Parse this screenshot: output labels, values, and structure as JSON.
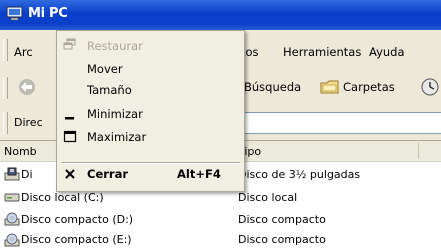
{
  "window": {
    "title": "Mi PC"
  },
  "menubar": {
    "items": [
      "Arc",
      "tos",
      "Herramientas",
      "Ayuda"
    ]
  },
  "toolbar": {
    "search_label": "Búsqueda",
    "folders_label": "Carpetas"
  },
  "address": {
    "label": "Direc"
  },
  "list": {
    "headers": {
      "name": "Nomb",
      "type": "Tipo"
    },
    "rows": [
      {
        "name": "Di",
        "type": "Disco de 3½ pulgadas",
        "icon": "floppy-drive-icon"
      },
      {
        "name": "Disco local (C:)",
        "type": "Disco local",
        "icon": "hard-drive-icon"
      },
      {
        "name": "Disco compacto (D:)",
        "type": "Disco compacto",
        "icon": "cd-drive-icon"
      },
      {
        "name": "Disco compacto (E:)",
        "type": "Disco compacto",
        "icon": "cd-drive-icon"
      }
    ]
  },
  "system_menu": {
    "restore": "Restaurar",
    "move": "Mover",
    "size": "Tamaño",
    "minimize": "Minimizar",
    "maximize": "Maximizar",
    "close": "Cerrar",
    "close_shortcut": "Alt+F4"
  },
  "colors": {
    "titlebar": "#0a3fc9",
    "menu_bg": "#f1efe2",
    "chrome": "#ece9d8",
    "disabled_text": "#aca899"
  }
}
